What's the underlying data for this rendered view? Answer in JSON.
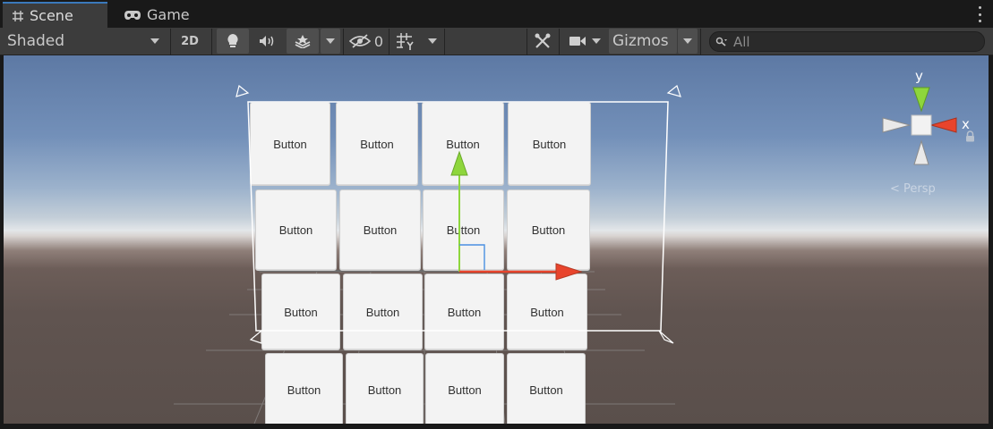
{
  "tabs": [
    {
      "label": "Scene",
      "icon": "grid-hash-icon",
      "active": true
    },
    {
      "label": "Game",
      "icon": "gamepad-icon",
      "active": false
    }
  ],
  "toolbar": {
    "shading_mode": "Shaded",
    "mode_2d_label": "2D",
    "hidden_count": "0",
    "gizmos_label": "Gizmos",
    "search_placeholder": "All"
  },
  "scene": {
    "button_label": "Button",
    "gizmo_y_label": "y",
    "gizmo_x_label": "x",
    "projection_label": "Persp"
  },
  "colors": {
    "axis_x": "#e8442c",
    "axis_y": "#8ed63c",
    "axis_z": "#4a90e2",
    "accent_tab": "#3a79bb"
  }
}
